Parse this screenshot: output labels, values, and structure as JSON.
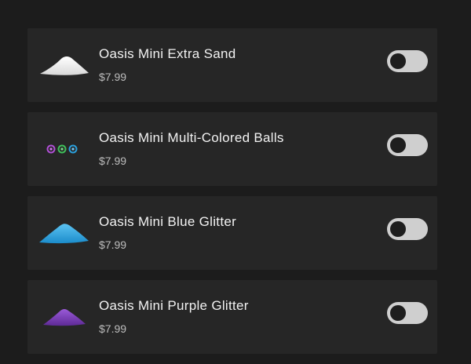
{
  "products": [
    {
      "name": "Oasis Mini Extra Sand",
      "price": "$7.99",
      "icon": "sand-pile-icon",
      "color": "#f4f4f4",
      "enabled": false
    },
    {
      "name": "Oasis Mini Multi-Colored Balls",
      "price": "$7.99",
      "icon": "colored-balls-icon",
      "color": "#a24bd0",
      "enabled": false
    },
    {
      "name": "Oasis Mini Blue Glitter",
      "price": "$7.99",
      "icon": "blue-glitter-pile-icon",
      "color": "#2aa4e0",
      "enabled": false
    },
    {
      "name": "Oasis Mini Purple Glitter",
      "price": "$7.99",
      "icon": "purple-glitter-pile-icon",
      "color": "#7b3fb8",
      "enabled": false
    }
  ],
  "colors": {
    "background": "#1c1c1c",
    "card": "#262626",
    "toggle_track_off": "#cfcfcf",
    "toggle_knob": "#1e1e1e"
  }
}
